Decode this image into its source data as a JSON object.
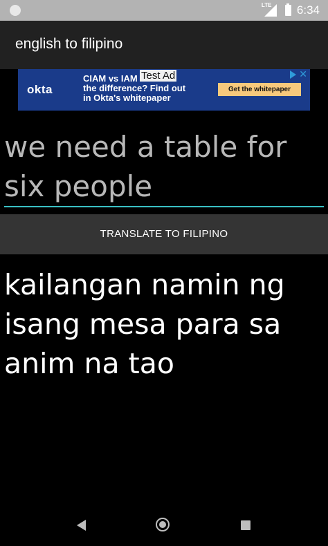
{
  "status_bar": {
    "network_label": "LTE",
    "time": "6:34",
    "icons": [
      "notification-dot-icon",
      "signal-icon",
      "battery-icon"
    ]
  },
  "app_bar": {
    "title": "english to filipino"
  },
  "ad": {
    "logo": "okta",
    "headline_lines": [
      "CIAM vs IAM",
      "the difference? Find out",
      "in Okta's whitepaper"
    ],
    "test_label": "Test Ad",
    "cta": "Get the whitepaper",
    "colors": {
      "background": "#1a3b8a",
      "cta": "#f7c97c"
    }
  },
  "input": {
    "value": "we need a table for six people",
    "underline_color": "#39c0c3"
  },
  "translate_button": {
    "label": "TRANSLATE TO FILIPINO"
  },
  "output": {
    "text": "kailangan namin ng isang mesa para sa anim na tao"
  },
  "nav_bar": {
    "icons": [
      "back-icon",
      "home-icon",
      "recents-icon"
    ]
  }
}
